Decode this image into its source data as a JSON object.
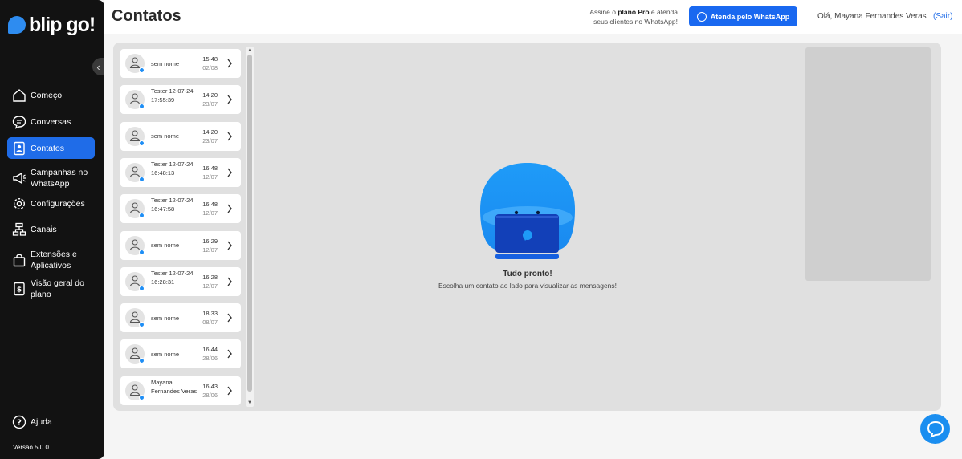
{
  "brand": {
    "logo_text": "blip go!",
    "accent": "#1f6ce8"
  },
  "sidebar": {
    "items": [
      {
        "label": "Começo",
        "icon": "home-icon"
      },
      {
        "label": "Conversas",
        "icon": "chat-icon"
      },
      {
        "label": "Contatos",
        "icon": "contacts-icon",
        "active": true
      },
      {
        "label": "Campanhas no WhatsApp",
        "icon": "megaphone-icon"
      },
      {
        "label": "Configurações",
        "icon": "gear-icon"
      },
      {
        "label": "Canais",
        "icon": "channels-icon"
      },
      {
        "label": "Extensões e Aplicativos",
        "icon": "bag-icon"
      },
      {
        "label": "Visão geral do plano",
        "icon": "plan-icon"
      }
    ],
    "help_label": "Ajuda",
    "version": "Versão  5.0.0"
  },
  "header": {
    "title": "Contatos",
    "promo_pre": "Assine o ",
    "promo_bold": "plano Pro",
    "promo_post": " e atenda seus clientes no WhatsApp!",
    "whatsapp_button": "Atenda pelo WhatsApp",
    "greeting": "Olá, Mayana Fernandes Veras",
    "logout": "(Sair)"
  },
  "contacts": [
    {
      "name": "sem nome",
      "time": "15:48",
      "date": "02/08"
    },
    {
      "name": "Tester 12-07-24 17:55:39",
      "time": "14:20",
      "date": "23/07"
    },
    {
      "name": "sem nome",
      "time": "14:20",
      "date": "23/07"
    },
    {
      "name": "Tester 12-07-24 16:48:13",
      "time": "16:48",
      "date": "12/07"
    },
    {
      "name": "Tester 12-07-24 16:47:58",
      "time": "16:48",
      "date": "12/07"
    },
    {
      "name": "sem nome",
      "time": "16:29",
      "date": "12/07"
    },
    {
      "name": "Tester 12-07-24 16:28:31",
      "time": "16:28",
      "date": "12/07"
    },
    {
      "name": "sem nome",
      "time": "18:33",
      "date": "08/07"
    },
    {
      "name": "sem nome",
      "time": "16:44",
      "date": "28/06"
    },
    {
      "name": "Mayana Fernandes Veras",
      "time": "16:43",
      "date": "28/06"
    }
  ],
  "empty_state": {
    "title": "Tudo pronto!",
    "subtitle": "Escolha um contato ao lado para visualizar as mensagens!"
  }
}
